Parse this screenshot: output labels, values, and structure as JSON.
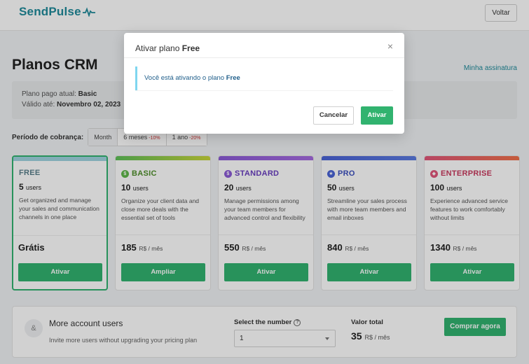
{
  "header": {
    "logo_text": "SendPulse",
    "back_button": "Voltar"
  },
  "page": {
    "title": "Planos CRM",
    "subscription_link": "Minha assinatura"
  },
  "info": {
    "current_plan_label": "Plano pago atual:",
    "current_plan_value": "Basic",
    "valid_until_label": "Válido até:",
    "valid_until_value": "Novembro 02, 2023"
  },
  "billing": {
    "label": "Período de cobrança:",
    "tabs": [
      {
        "label": "Month",
        "discount": ""
      },
      {
        "label": "6 meses",
        "discount": "-10%"
      },
      {
        "label": "1 ano",
        "discount": "-20%"
      }
    ]
  },
  "plans": [
    {
      "name": "FREE",
      "users": "5",
      "users_unit": "users",
      "description": "Get organized and manage your sales and communication channels in one place",
      "price": "Grátis",
      "price_unit": "",
      "button": "Ativar",
      "color": "#9fd4e0",
      "name_color": "#5a7f8c"
    },
    {
      "name": "BASIC",
      "users": "10",
      "users_unit": "users",
      "description": "Organize your client data and close more deals with the essential set of tools",
      "price": "185",
      "price_unit": "R$ / mês",
      "button": "Ampliar",
      "color": "#7cc84a",
      "name_color": "#4f8f2a"
    },
    {
      "name": "STANDARD",
      "users": "20",
      "users_unit": "users",
      "description": "Manage permissions among your team members for advanced control and flexibility",
      "price": "550",
      "price_unit": "R$ / mês",
      "button": "Ativar",
      "color": "#8b5bd6",
      "name_color": "#6a3fc0"
    },
    {
      "name": "PRO",
      "users": "50",
      "users_unit": "users",
      "description": "Streamline your sales process with more team members and email inboxes",
      "price": "840",
      "price_unit": "R$ / mês",
      "button": "Ativar",
      "color": "#4a63d6",
      "name_color": "#3b4fbf"
    },
    {
      "name": "ENTERPRISE",
      "users": "100",
      "users_unit": "users",
      "description": "Experience advanced service features to work comfortably without limits",
      "price": "1340",
      "price_unit": "R$ / mês",
      "button": "Ativar",
      "color": "#e0567a",
      "name_color": "#c93a5e"
    }
  ],
  "extra_users": {
    "title": "More account users",
    "subtitle": "Invite more users without upgrading your pricing plan",
    "select_label": "Select the number",
    "select_value": "1",
    "total_label": "Valor total",
    "total_value": "35",
    "total_unit": "R$ / mês",
    "buy_button": "Comprar agora"
  },
  "modal": {
    "title_prefix": "Ativar plano",
    "title_plan": "Free",
    "alert_prefix": "Você está ativando o plano",
    "alert_plan": "Free",
    "cancel_button": "Cancelar",
    "confirm_button": "Ativar"
  },
  "colors": {
    "accent": "#31b36f",
    "brand": "#1f8a9a"
  }
}
